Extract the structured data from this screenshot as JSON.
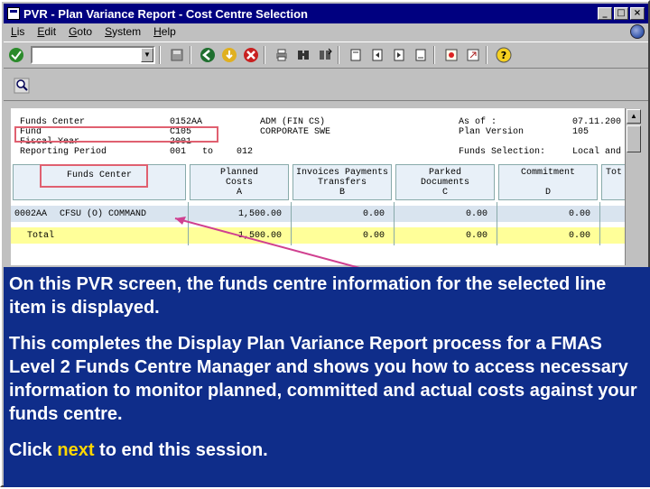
{
  "window": {
    "title": "PVR - Plan Variance Report - Cost Centre Selection",
    "btn_min": "_",
    "btn_max": "□",
    "btn_close": "×"
  },
  "menu": [
    {
      "u": "L",
      "rest": "is"
    },
    {
      "u": "E",
      "rest": "dit"
    },
    {
      "u": "G",
      "rest": "oto"
    },
    {
      "u": "S",
      "rest": "ystem"
    },
    {
      "u": "H",
      "rest": "elp"
    }
  ],
  "header": {
    "funds_center_label": "Funds Center",
    "funds_center_code": "0152AA",
    "funds_center_name": "ADM (FIN CS)",
    "fund_label": "Fund",
    "fund_code": "C105",
    "fund_name": "CORPORATE SWE",
    "fiscal_year_label": "Fiscal Year",
    "fiscal_year": "2001",
    "reporting_period_label": "Reporting Period",
    "period_from": "001",
    "period_to_word": "to",
    "period_to": "012",
    "as_of_label": "As of :",
    "as_of": "07.11.200",
    "plan_version_label": "Plan Version",
    "plan_version": "105",
    "funds_selection_label": "Funds Selection:",
    "funds_selection": "Local and"
  },
  "columns": {
    "funds_center": [
      "Funds Center"
    ],
    "planned": [
      "Planned",
      "Costs",
      "A"
    ],
    "invoices": [
      "Invoices Payments",
      "Transfers",
      "B"
    ],
    "parked": [
      "Parked",
      "Documents",
      "C"
    ],
    "commitment": [
      "Commitment",
      "",
      "D"
    ],
    "total": [
      "Tot"
    ]
  },
  "row": {
    "code": "0002AA",
    "name": "CFSU (O) COMMAND",
    "planned": "1,500.00",
    "invoices": "0.00",
    "parked": "0.00",
    "commitment": "0.00"
  },
  "total_row": {
    "label": "Total",
    "planned": "1,500.00",
    "invoices": "0.00",
    "parked": "0.00",
    "commitment": "0.00"
  },
  "overlay": {
    "p1": "On this PVR screen, the funds centre information for the selected line item is displayed.",
    "p2": "This completes the Display Plan Variance Report process for a FMAS Level 2 Funds Centre Manager and shows you how to access necessary information to monitor planned, committed and actual costs against your funds centre.",
    "p3_before": "Click ",
    "p3_link": "next",
    "p3_after": " to end this session."
  },
  "colors": {
    "titlebar": "#000080",
    "overlay_bg": "#0f2d8a",
    "highlight": "#e06070",
    "link": "#ffd700"
  }
}
